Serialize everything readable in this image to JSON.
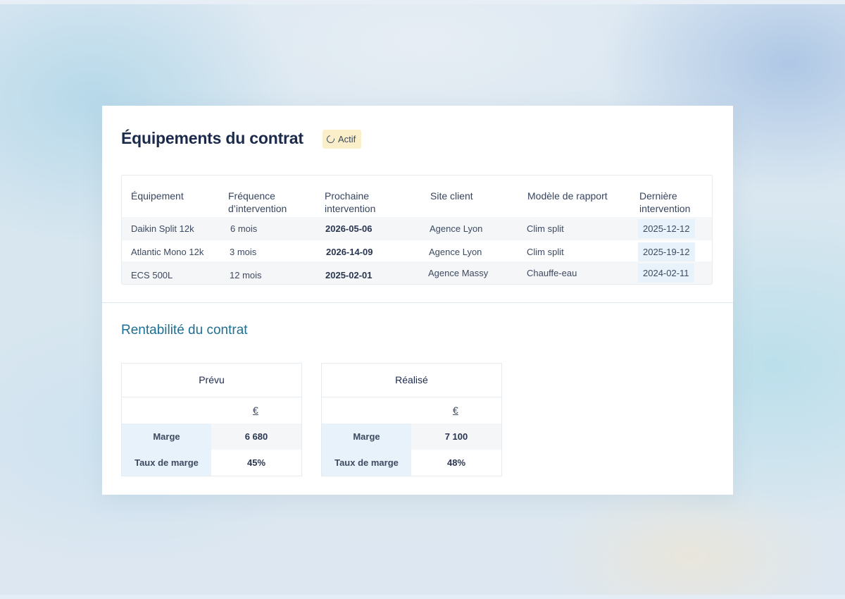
{
  "equipment_section": {
    "title": "Équipements du contrat",
    "status_badge": "Actif",
    "columns": [
      "Équipement",
      "Fréquence\nd’intervention",
      "Prochaine\nintervention",
      "Site client",
      "Modèle de rapport",
      "Dernière\nintervention"
    ],
    "rows": [
      {
        "equipment": "Daikin Split 12k",
        "frequency": "6 mois",
        "next": "2026-05-06",
        "site": "Agence Lyon",
        "model": "Clim split",
        "last": "2025-12-12"
      },
      {
        "equipment": "Atlantic Mono 12k",
        "frequency": "3 mois",
        "next": "2026-14-09",
        "site": "Agence Lyon",
        "model": "Clim split",
        "last": "2025-19-12"
      },
      {
        "equipment": "ECS 500L",
        "frequency": "12 mois",
        "next": "2025-02-01",
        "site": "Agence Massy",
        "model": "Chauffe-eau",
        "last": "2024-02-11"
      }
    ]
  },
  "profit_section": {
    "title": "Rentabilité du contrat",
    "cards": [
      {
        "heading": "Prévu",
        "unit": "€",
        "rows": [
          {
            "label": "Marge",
            "value": "6 680"
          },
          {
            "label": "Taux de marge",
            "value": "45%"
          }
        ]
      },
      {
        "heading": "Réalisé",
        "unit": "€",
        "rows": [
          {
            "label": "Marge",
            "value": "7 100"
          },
          {
            "label": "Taux de marge",
            "value": "48%"
          }
        ]
      }
    ]
  },
  "colors": {
    "title": "#1b2a4a",
    "subtitle": "#1e6f93",
    "badge_bg": "#fbefc9",
    "label_bg": "#e7f2fb",
    "stripe_bg": "#f4f6f8"
  }
}
